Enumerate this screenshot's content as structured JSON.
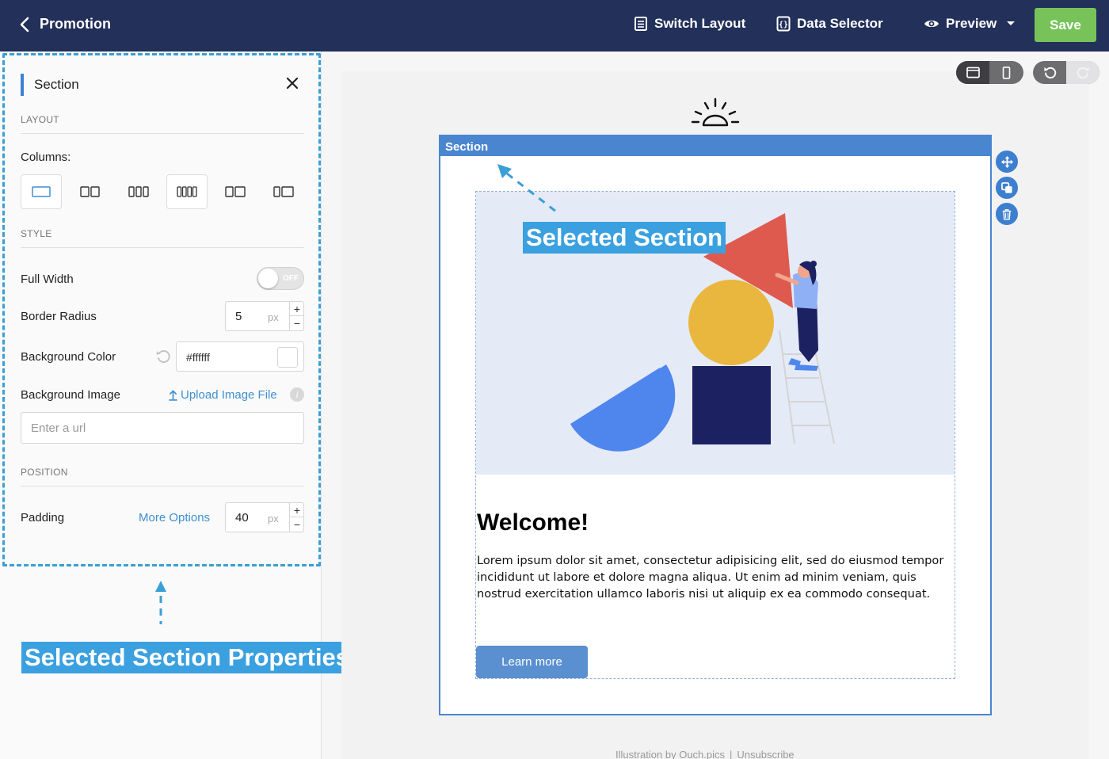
{
  "topbar": {
    "back_label": "Promotion",
    "switch_layout": "Switch Layout",
    "data_selector": "Data Selector",
    "preview": "Preview",
    "save": "Save"
  },
  "panel": {
    "title": "Section",
    "layout_group": "LAYOUT",
    "columns_label": "Columns:",
    "column_options": [
      1,
      2,
      3,
      4,
      "1:2",
      "2:1"
    ],
    "selected_column_option": 1,
    "style_group": "STYLE",
    "full_width_label": "Full Width",
    "full_width_state": "OFF",
    "border_radius_label": "Border Radius",
    "border_radius_value": "5",
    "unit": "px",
    "bg_color_label": "Background Color",
    "bg_color_value": "#ffffff",
    "bg_image_label": "Background Image",
    "upload_label": "Upload Image File",
    "url_placeholder": "Enter a url",
    "position_group": "POSITION",
    "padding_label": "Padding",
    "more_options": "More Options",
    "padding_value": "40"
  },
  "callouts": {
    "properties": "Selected Section Properties",
    "section": "Selected Section"
  },
  "canvas": {
    "section_label": "Section",
    "heading": "Welcome!",
    "body": "Lorem ipsum dolor sit amet, consectetur adipisicing elit, sed do eiusmod tempor incididunt ut labore et dolore magna aliqua. Ut enim ad minim veniam, quis nostrud exercitation ullamco laboris nisi ut aliquip ex ea commodo consequat.",
    "button": "Learn more",
    "footer_credit": "Illustration by Ouch.pics",
    "footer_sep": "|",
    "footer_unsubscribe": "Unsubscribe"
  },
  "colors": {
    "topbar": "#22305a",
    "save": "#77c35a",
    "accent": "#4a86d0",
    "callout": "#3aa0e0",
    "link": "#3f8fd0"
  }
}
